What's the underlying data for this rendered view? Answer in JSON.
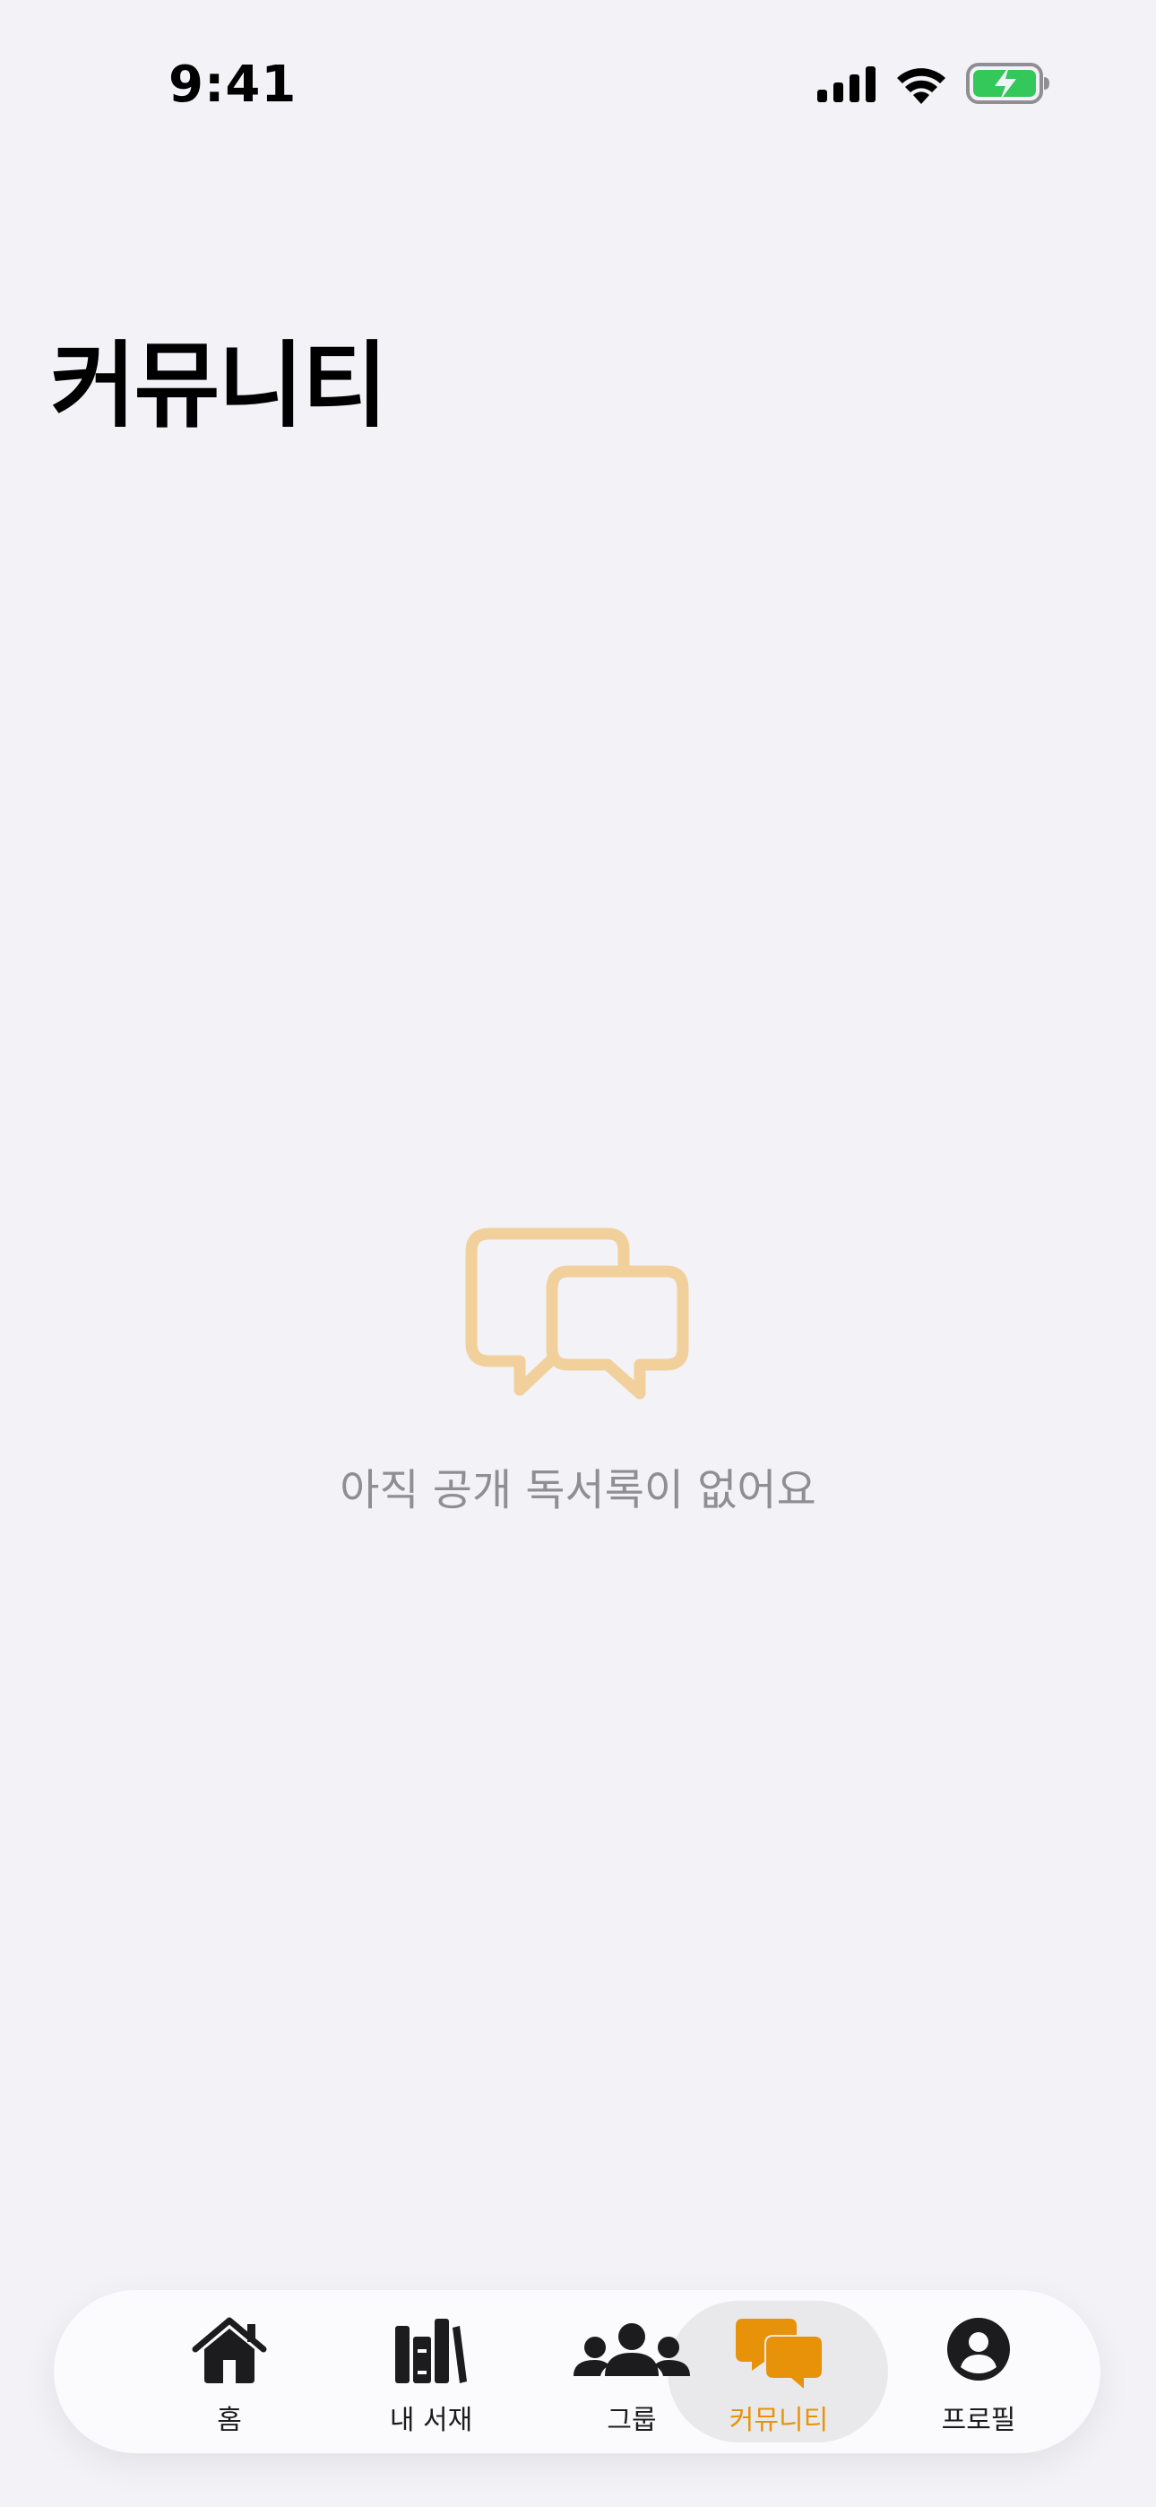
{
  "status_bar": {
    "time": "9:41"
  },
  "page": {
    "title": "커뮤니티"
  },
  "empty_state": {
    "icon": "chat-bubbles-icon",
    "message": "아직 공개 독서록이 없어요"
  },
  "tab_bar": {
    "active_color": "#E8920A",
    "items": [
      {
        "label": "홈",
        "icon": "house-icon"
      },
      {
        "label": "내 서재",
        "icon": "books-icon"
      },
      {
        "label": "그룹",
        "icon": "people-icon"
      },
      {
        "label": "커뮤니티",
        "icon": "chat-bubbles-icon",
        "active": true
      },
      {
        "label": "프로필",
        "icon": "person-circle-icon"
      }
    ]
  }
}
